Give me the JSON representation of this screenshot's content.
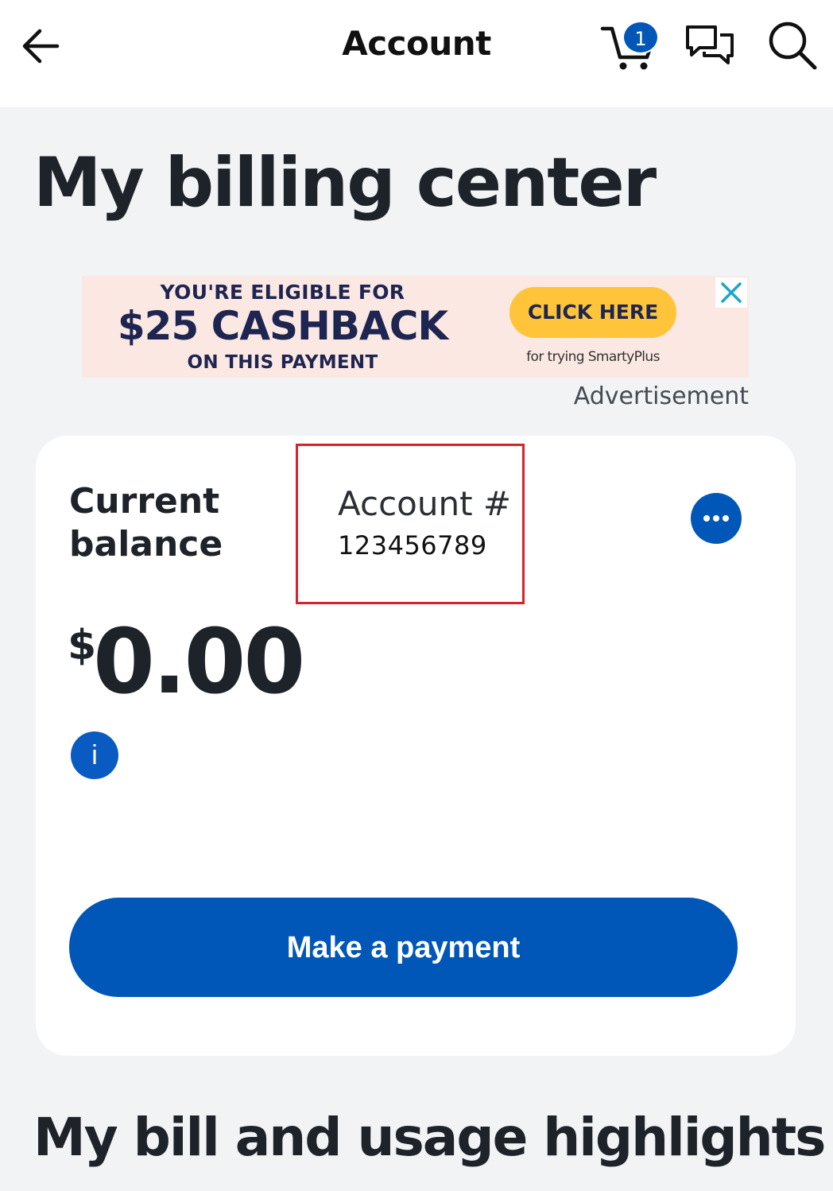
{
  "header": {
    "title": "Account",
    "cart_count": "1",
    "icons": {
      "back": "arrow-left-icon",
      "cart": "cart-icon",
      "chat": "chat-icon",
      "search": "search-icon"
    }
  },
  "page": {
    "title": "My billing center"
  },
  "ad": {
    "eligible_text": "YOU'RE ELIGIBLE FOR",
    "cashback_text": "$25 CASHBACK",
    "payment_text": "ON THIS PAYMENT",
    "cta_label": "CLICK HERE",
    "note_text": "for trying SmartyPlus",
    "label": "Advertisement",
    "close_icon": "close-icon"
  },
  "balance_card": {
    "label": "Current balance",
    "account_label": "Account #",
    "account_number": "123456789",
    "currency_symbol": "$",
    "amount": "0.00",
    "info_glyph": "i",
    "pay_button_label": "Make a payment"
  },
  "section": {
    "title": "My bill and usage highlights"
  },
  "colors": {
    "brand_blue": "#0057b8",
    "page_background": "#f2f3f5",
    "highlight_border": "#d9222a",
    "ad_background": "#fbe8e3",
    "ad_button": "#ffc439"
  }
}
